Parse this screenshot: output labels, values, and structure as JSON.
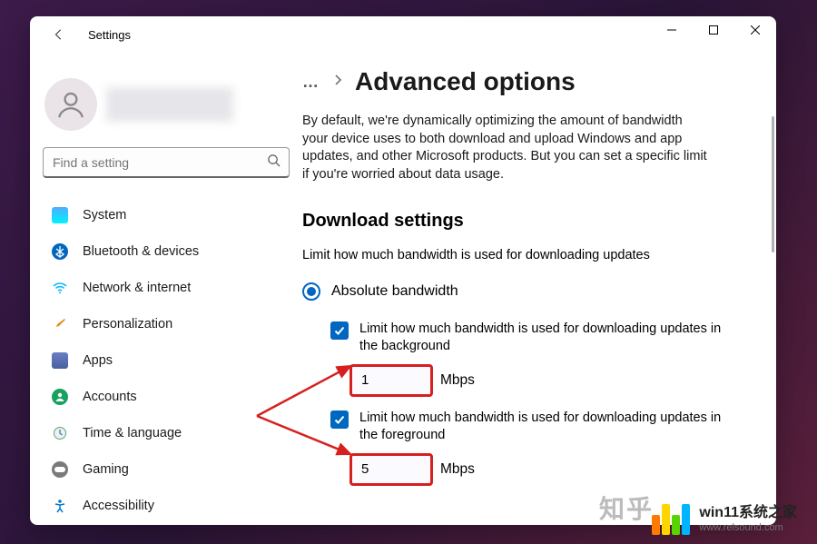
{
  "app_title": "Settings",
  "breadcrumb": {
    "page_title": "Advanced options"
  },
  "description": "By default, we're dynamically optimizing the amount of bandwidth your device uses to both download and upload Windows and app updates, and other Microsoft products. But you can set a specific limit if you're worried about data usage.",
  "search": {
    "placeholder": "Find a setting"
  },
  "sidebar": {
    "items": [
      {
        "label": "System"
      },
      {
        "label": "Bluetooth & devices"
      },
      {
        "label": "Network & internet"
      },
      {
        "label": "Personalization"
      },
      {
        "label": "Apps"
      },
      {
        "label": "Accounts"
      },
      {
        "label": "Time & language"
      },
      {
        "label": "Gaming"
      },
      {
        "label": "Accessibility"
      }
    ]
  },
  "download_settings": {
    "heading": "Download settings",
    "sub_desc": "Limit how much bandwidth is used for downloading updates",
    "radio_absolute": "Absolute bandwidth",
    "bg_label": "Limit how much bandwidth is used for downloading updates in the background",
    "bg_value": "1",
    "fg_label": "Limit how much bandwidth is used for downloading updates in the foreground",
    "fg_value": "5",
    "unit": "Mbps"
  },
  "watermark": {
    "zhihu": "知乎",
    "site_cn": "win11系统之家",
    "site_url": "www.relsound.com"
  }
}
